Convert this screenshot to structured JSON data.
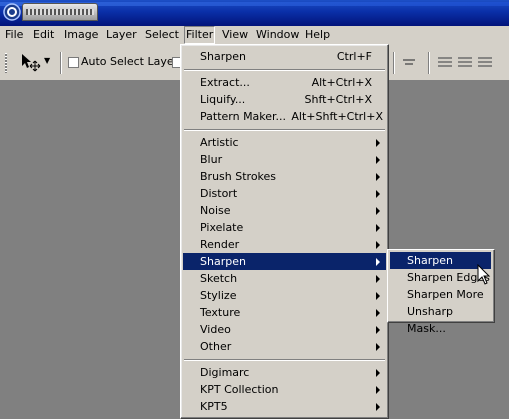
{
  "colors": {
    "titlebar": "#0a2fa8",
    "highlight": "#0a246a",
    "workspace": "#808080",
    "chrome": "#d4d0c8"
  },
  "menubar": {
    "items": [
      {
        "id": "file",
        "label": "File"
      },
      {
        "id": "edit",
        "label": "Edit"
      },
      {
        "id": "image",
        "label": "Image"
      },
      {
        "id": "layer",
        "label": "Layer"
      },
      {
        "id": "select",
        "label": "Select"
      },
      {
        "id": "filter",
        "label": "Filter"
      },
      {
        "id": "view",
        "label": "View"
      },
      {
        "id": "window",
        "label": "Window"
      },
      {
        "id": "help",
        "label": "Help"
      }
    ],
    "active": "Filter"
  },
  "options_bar": {
    "tool_icon": "move-tool-icon",
    "auto_select_layer_label": "Auto Select Layer",
    "auto_select_layer_checked": false
  },
  "filter_menu": {
    "items": [
      {
        "label": "Sharpen",
        "shortcut": "Ctrl+F"
      },
      {
        "label": "Extract...",
        "shortcut": "Alt+Ctrl+X"
      },
      {
        "label": "Liquify...",
        "shortcut": "Shft+Ctrl+X"
      },
      {
        "label": "Pattern Maker...",
        "shortcut": "Alt+Shft+Ctrl+X"
      },
      {
        "label": "Artistic"
      },
      {
        "label": "Blur"
      },
      {
        "label": "Brush Strokes"
      },
      {
        "label": "Distort"
      },
      {
        "label": "Noise"
      },
      {
        "label": "Pixelate"
      },
      {
        "label": "Render"
      },
      {
        "label": "Sharpen"
      },
      {
        "label": "Sketch"
      },
      {
        "label": "Stylize"
      },
      {
        "label": "Texture"
      },
      {
        "label": "Video"
      },
      {
        "label": "Other"
      },
      {
        "label": "Digimarc"
      },
      {
        "label": "KPT Collection"
      },
      {
        "label": "KPT5"
      }
    ],
    "highlighted": "Sharpen"
  },
  "sharpen_submenu": {
    "items": [
      {
        "label": "Sharpen"
      },
      {
        "label": "Sharpen Edges"
      },
      {
        "label": "Sharpen More"
      },
      {
        "label": "Unsharp Mask..."
      }
    ],
    "highlighted": "Sharpen"
  }
}
